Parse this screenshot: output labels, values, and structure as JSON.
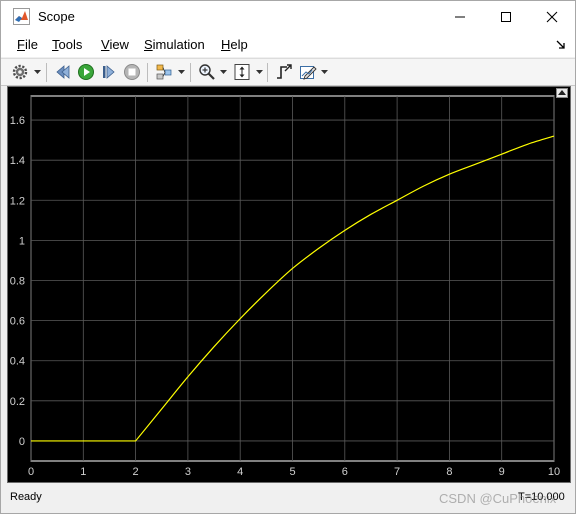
{
  "window": {
    "title": "Scope",
    "minimize_glyph": "—",
    "maximize_glyph": "☐",
    "close_glyph": "✕"
  },
  "menu": {
    "items": [
      {
        "label": "File",
        "ul": "F",
        "rest": "ile"
      },
      {
        "label": "Tools",
        "ul": "T",
        "rest": "ools"
      },
      {
        "label": "View",
        "ul": "V",
        "rest": "iew"
      },
      {
        "label": "Simulation",
        "ul": "S",
        "rest": "imulation"
      },
      {
        "label": "Help",
        "ul": "H",
        "rest": "elp"
      }
    ]
  },
  "toolbar": {
    "icons": [
      "gear-icon",
      "step-back-icon",
      "run-icon",
      "step-forward-icon",
      "stop-icon",
      "signal-selector-icon",
      "zoom-icon",
      "fit-axes-icon",
      "triggers-icon",
      "style-icon"
    ]
  },
  "chart_data": {
    "type": "line",
    "title": "",
    "xlabel": "",
    "ylabel": "",
    "xlim": [
      0,
      10
    ],
    "ylim": [
      -0.1,
      1.72
    ],
    "xticks": [
      0,
      1,
      2,
      3,
      4,
      5,
      6,
      7,
      8,
      9,
      10
    ],
    "yticks": [
      0,
      0.2,
      0.4,
      0.6,
      0.8,
      1,
      1.2,
      1.4,
      1.6
    ],
    "grid": true,
    "background": "#000000",
    "series": [
      {
        "color": "#ffff00",
        "x": [
          0,
          1,
          2,
          2.5,
          3,
          3.5,
          4,
          4.5,
          5,
          5.5,
          6,
          6.5,
          7,
          7.5,
          8,
          8.5,
          9,
          9.5,
          10
        ],
        "y": [
          0,
          0,
          0,
          0.16,
          0.32,
          0.47,
          0.61,
          0.74,
          0.86,
          0.96,
          1.05,
          1.13,
          1.2,
          1.27,
          1.33,
          1.38,
          1.43,
          1.48,
          1.52
        ]
      }
    ]
  },
  "status": {
    "text": "Ready",
    "time": "T=10.000"
  },
  "watermark": "CSDN @CuPhoenix"
}
